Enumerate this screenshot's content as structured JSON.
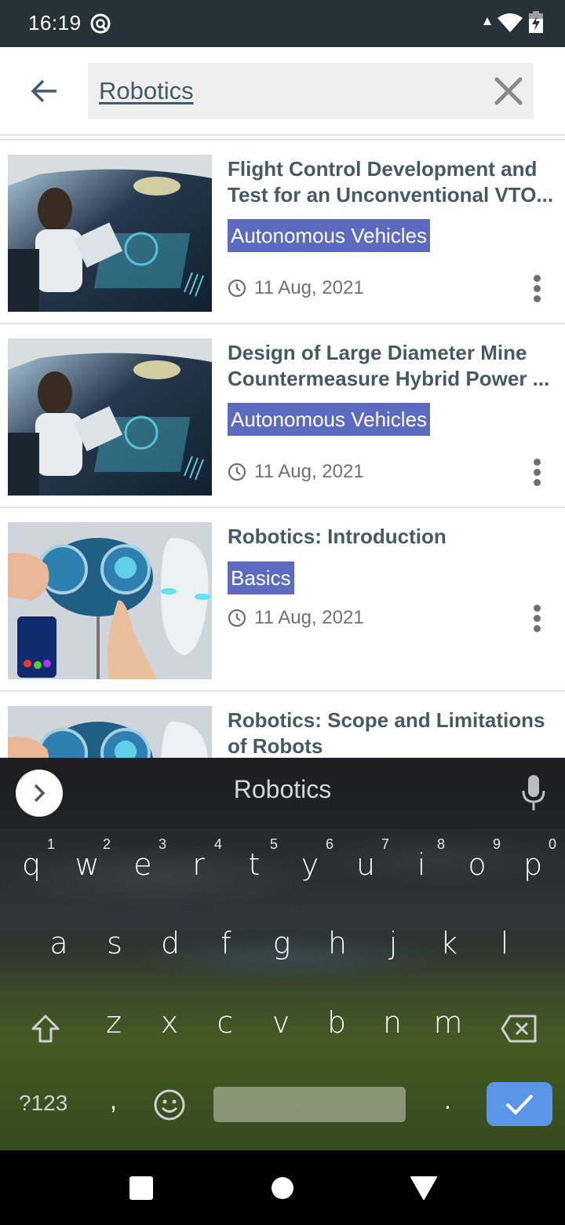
{
  "status_bar": {
    "time": "16:19",
    "left_icons": [
      "q-circle-icon"
    ],
    "right_icons": [
      "signal-up-arrow-icon",
      "wifi-icon",
      "battery-charging-icon"
    ]
  },
  "search": {
    "back_icon": "arrow-left-icon",
    "query": "Robotics",
    "clear_icon": "close-icon"
  },
  "results": [
    {
      "title": "Flight Control Development and Test for an Unconventional VTO...",
      "tag": "Autonomous Vehicles",
      "date": "11 Aug, 2021",
      "image": "autonomous-car-interior",
      "menu_icon": "more-vertical-icon"
    },
    {
      "title": "Design of Large Diameter Mine Countermeasure Hybrid Power ...",
      "tag": "Autonomous Vehicles",
      "date": "11 Aug, 2021",
      "image": "autonomous-car-interior",
      "menu_icon": "more-vertical-icon"
    },
    {
      "title": "Robotics: Introduction",
      "tag": "Basics",
      "date": "11 Aug, 2021",
      "image": "robot-mechanism-hands",
      "menu_icon": "more-vertical-icon"
    },
    {
      "title": "Robotics: Scope and Limitations of Robots",
      "tag": "",
      "date": "",
      "image": "robot-mechanism-hands",
      "menu_icon": "more-vertical-icon"
    }
  ],
  "keyboard": {
    "suggestion": "Robotics",
    "row1": [
      {
        "key": "q",
        "hint": "1"
      },
      {
        "key": "w",
        "hint": "2"
      },
      {
        "key": "e",
        "hint": "3"
      },
      {
        "key": "r",
        "hint": "4"
      },
      {
        "key": "t",
        "hint": "5"
      },
      {
        "key": "y",
        "hint": "6"
      },
      {
        "key": "u",
        "hint": "7"
      },
      {
        "key": "i",
        "hint": "8"
      },
      {
        "key": "o",
        "hint": "9"
      },
      {
        "key": "p",
        "hint": "0"
      }
    ],
    "row2": [
      "a",
      "s",
      "d",
      "f",
      "g",
      "h",
      "j",
      "k",
      "l"
    ],
    "row3": [
      "z",
      "x",
      "c",
      "v",
      "b",
      "n",
      "m"
    ],
    "symbols_label": "?123",
    "comma": ",",
    "period": ".",
    "colors": {
      "enter": "#5a95e8"
    }
  },
  "nav": {
    "buttons": [
      "recents-icon",
      "home-icon",
      "back-triangle-icon"
    ]
  },
  "colors": {
    "status_bar": "#263238",
    "title_text": "#455a64",
    "tag_bg": "#5c6bc0",
    "meta_text": "#707070"
  }
}
